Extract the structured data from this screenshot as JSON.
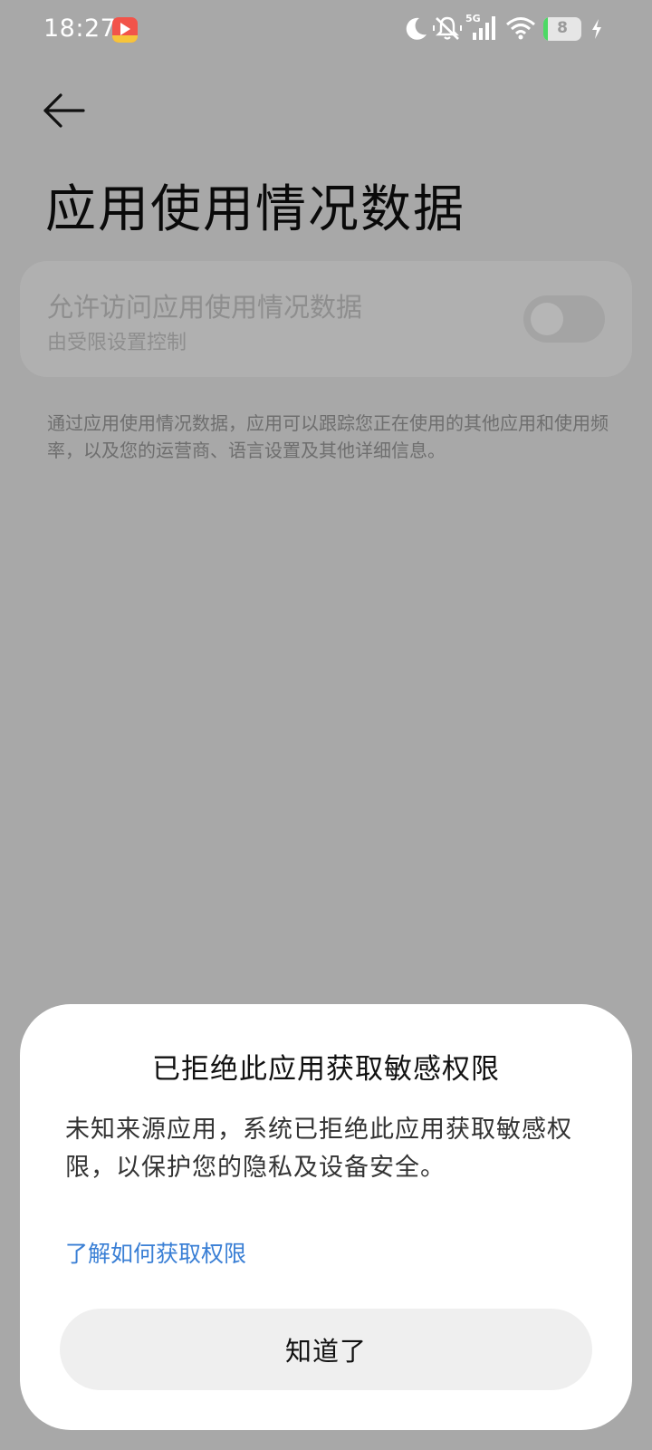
{
  "status_bar": {
    "time": "18:27",
    "battery_level": "8",
    "network_label": "5G"
  },
  "header": {
    "title": "应用使用情况数据"
  },
  "setting": {
    "title": "允许访问应用使用情况数据",
    "subtitle": "由受限设置控制",
    "toggle_on": false
  },
  "description": "通过应用使用情况数据，应用可以跟踪您正在使用的其他应用和使用频率，以及您的运营商、语言设置及其他详细信息。",
  "dialog": {
    "title": "已拒绝此应用获取敏感权限",
    "body": "未知来源应用，系统已拒绝此应用获取敏感权限，以保护您的隐私及设备安全。",
    "link": "了解如何获取权限",
    "button": "知道了"
  },
  "colors": {
    "scrim": "#a8a8a8",
    "link": "#3a7fd5",
    "battery_green": "#4cd964"
  }
}
